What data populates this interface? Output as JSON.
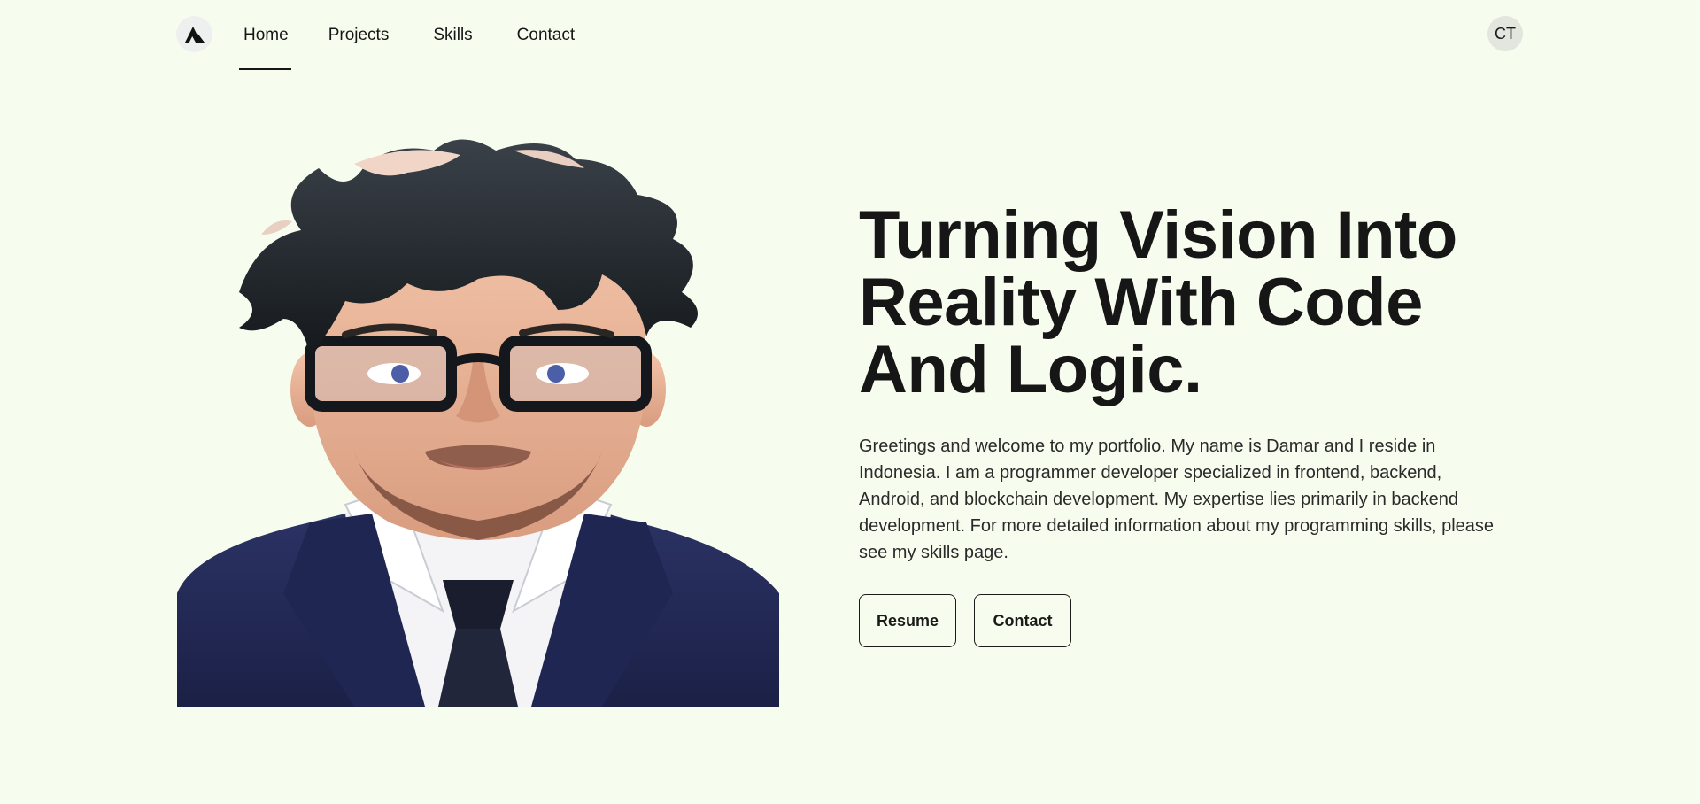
{
  "header": {
    "logo_icon": "triangle-logo-icon",
    "nav": [
      {
        "label": "Home",
        "active": true
      },
      {
        "label": "Projects",
        "active": false
      },
      {
        "label": "Skills",
        "active": false
      },
      {
        "label": "Contact",
        "active": false
      }
    ],
    "avatar_initials": "CT"
  },
  "hero": {
    "title_lines": [
      "Turning Vision Into",
      "Reality With Code",
      "And Logic."
    ],
    "description": "Greetings and welcome to my portfolio. My name is Damar and I reside in Indonesia. I am a programmer developer specialized in frontend, backend, Android, and blockchain development. My expertise lies primarily in backend development. For more detailed information about my programming skills, please see my skills page.",
    "buttons": {
      "resume": "Resume",
      "contact": "Contact"
    },
    "portrait_icon": "developer-portrait-illustration"
  },
  "colors": {
    "background": "#f7fdee",
    "text": "#161616",
    "suit": "#232a56",
    "hair": "#20262b"
  }
}
